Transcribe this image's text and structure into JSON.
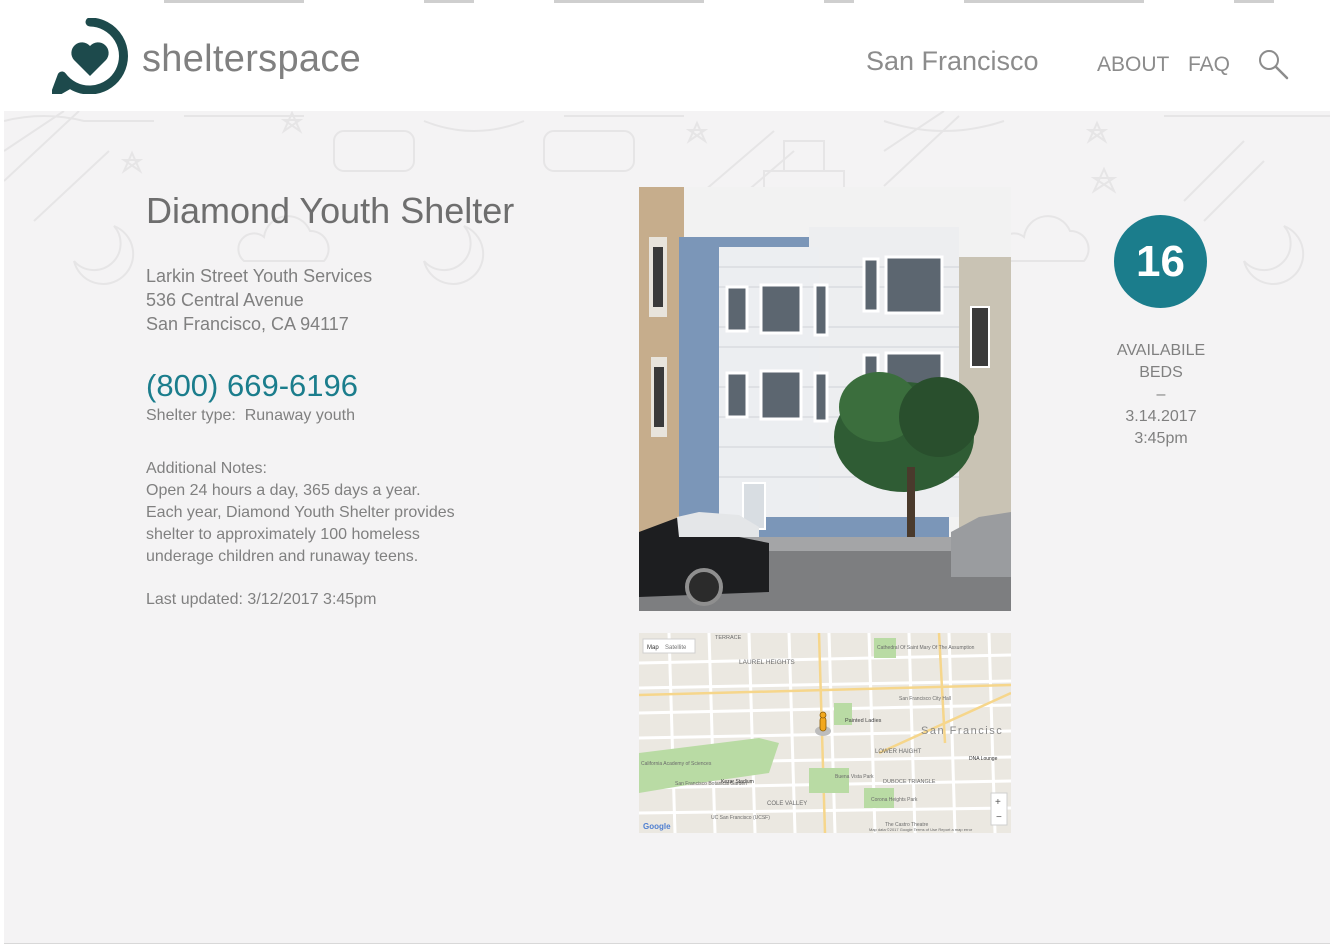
{
  "header": {
    "brand": "shelterspace",
    "city": "San Francisco",
    "nav": {
      "about": "ABOUT",
      "faq": "FAQ"
    },
    "icons": {
      "logo": "heart-in-circle-icon",
      "search": "search-icon"
    }
  },
  "shelter": {
    "name": "Diamond Youth Shelter",
    "organization": "Larkin Street Youth Services",
    "street": "536 Central Avenue",
    "city_line": "San Francisco, CA 94117",
    "phone": "(800) 669-6196",
    "type_label": "Shelter type:",
    "type_value": "Runaway youth",
    "notes_heading": "Additional Notes:",
    "notes_lines": [
      "Open 24 hours a day, 365 days a year.",
      "Each year, Diamond Youth Shelter provides",
      "shelter to approximately 100 homeless",
      "underage children and runaway teens."
    ],
    "last_updated": "Last updated: 3/12/2017 3:45pm"
  },
  "availability": {
    "beds": "16",
    "label_line1": "AVAILABILE",
    "label_line2": "BEDS",
    "separator": "–",
    "date": "3.14.2017",
    "time": "3:45pm"
  },
  "map": {
    "tabs": [
      "Map",
      "Satellite"
    ],
    "labels": {
      "laurel": "LAUREL HEIGHTS",
      "cathedral": "Cathedral Of Saint Mary Of The Assumption",
      "sf": "San Francisc",
      "city_hall": "San Francisco City Hall",
      "painted": "Painted Ladies",
      "lower_haight": "LOWER HAIGHT",
      "duboce": "DUBOCE TRIANGLE",
      "cole_valley": "COLE VALLEY",
      "kezar": "Kezar Stadium",
      "buena": "Buena Vista Park",
      "corona": "Corona Heights Park",
      "academy": "California Academy of Sciences",
      "botanical": "San Francisco Botanical Garden",
      "ucsf": "UC San Francisco (UCSF)",
      "dna": "DNA Lounge",
      "terrace": "TERRACE",
      "castro": "The Castro Theatre",
      "google": "Google",
      "attribution": "Map data ©2017 Google   Terms of Use   Report a map error",
      "zoom_in": "+",
      "zoom_out": "−"
    }
  },
  "colors": {
    "accent": "#1b7d8c",
    "logo": "#1d4a4c",
    "background": "#f4f3f4"
  }
}
